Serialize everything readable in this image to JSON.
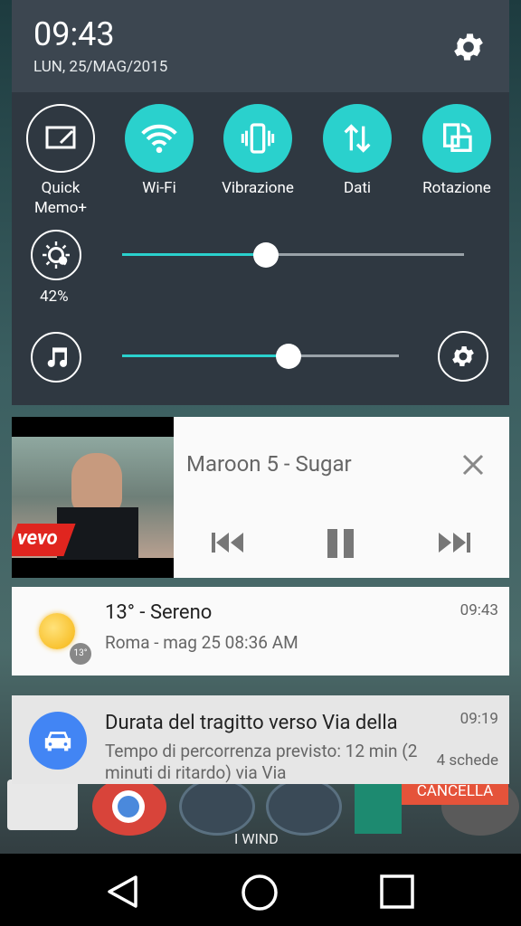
{
  "status": {
    "time": "09:43",
    "date": "LUN, 25/MAG/2015"
  },
  "quick_settings": {
    "tiles": [
      {
        "label": "Quick\nMemo+",
        "icon": "quickmemo-icon",
        "state": "off"
      },
      {
        "label": "Wi-Fi",
        "icon": "wifi-icon",
        "state": "on"
      },
      {
        "label": "Vibrazione",
        "icon": "vibrate-icon",
        "state": "on"
      },
      {
        "label": "Dati",
        "icon": "data-transfer-icon",
        "state": "on"
      },
      {
        "label": "Rotazione",
        "icon": "rotation-icon",
        "state": "on"
      }
    ],
    "brightness": {
      "label": "42%",
      "level": 0.42
    },
    "volume": {
      "level": 0.6
    }
  },
  "music": {
    "title": "Maroon 5 - Sugar",
    "thumb_logo": "vevo"
  },
  "weather": {
    "main": "13° -  Sereno",
    "sub": "Roma - mag 25  08:36 AM",
    "time": "09:43",
    "badge": "13°"
  },
  "traffic": {
    "title": "Durata del tragitto verso Via della",
    "body": "Tempo di percorrenza previsto: 12 min (2 minuti di ritardo) via Via",
    "time": "09:19",
    "count": "4 schede"
  },
  "background": {
    "cancel_label": "CANCELLA",
    "carrier": "I WIND"
  },
  "colors": {
    "accent": "#2ad1cd",
    "header": "#3c4650",
    "panel": "#2f3841"
  }
}
